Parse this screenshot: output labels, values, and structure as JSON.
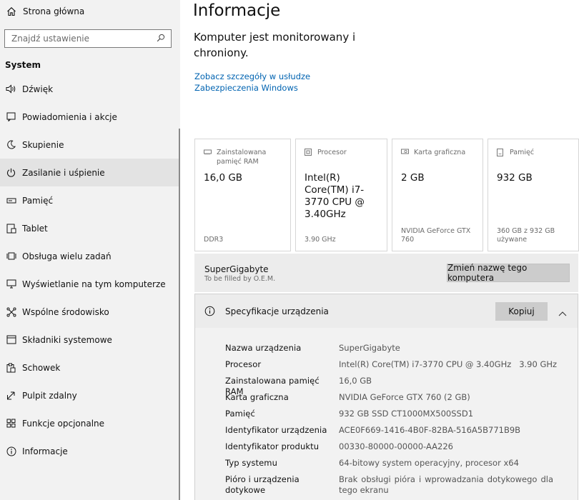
{
  "sidebar": {
    "home_label": "Strona główna",
    "search_placeholder": "Znajdź ustawienie",
    "section_title": "System",
    "items": [
      {
        "label": "Dźwięk",
        "icon": "speaker-icon"
      },
      {
        "label": "Powiadomienia i akcje",
        "icon": "notification-icon"
      },
      {
        "label": "Skupienie",
        "icon": "moon-icon"
      },
      {
        "label": "Zasilanie i uśpienie",
        "icon": "power-icon",
        "active": true
      },
      {
        "label": "Pamięć",
        "icon": "storage-icon"
      },
      {
        "label": "Tablet",
        "icon": "tablet-icon"
      },
      {
        "label": "Obsługa wielu zadań",
        "icon": "multitasking-icon"
      },
      {
        "label": "Wyświetlanie na tym komputerze",
        "icon": "projecting-icon"
      },
      {
        "label": "Wspólne środowisko",
        "icon": "shared-experiences-icon"
      },
      {
        "label": "Składniki systemowe",
        "icon": "system-components-icon"
      },
      {
        "label": "Schowek",
        "icon": "clipboard-icon"
      },
      {
        "label": "Pulpit zdalny",
        "icon": "remote-desktop-icon"
      },
      {
        "label": "Funkcje opcjonalne",
        "icon": "optional-features-icon"
      },
      {
        "label": "Informacje",
        "icon": "info-icon"
      }
    ]
  },
  "main": {
    "title": "Informacje",
    "protected_text": "Komputer jest monitorowany i chroniony.",
    "security_link": "Zobacz szczegóły w usłudze Zabezpieczenia Windows",
    "cards": [
      {
        "label": "Zainstalowana pamięć RAM",
        "value": "16,0 GB",
        "footer": "DDR3",
        "icon": "ram-icon"
      },
      {
        "label": "Procesor",
        "value": "Intel(R) Core(TM) i7-3770 CPU @ 3.40GHz",
        "footer": "3.90 GHz",
        "icon": "processor-icon"
      },
      {
        "label": "Karta graficzna",
        "value": "2 GB",
        "footer": "NVIDIA GeForce GTX 760",
        "icon": "graphics-card-icon"
      },
      {
        "label": "Pamięć",
        "value": "932 GB",
        "footer": "360 GB z 932 GB używane",
        "icon": "storage-icon"
      }
    ],
    "device": {
      "name": "SuperGigabyte",
      "oem": "To be filled by O.E.M.",
      "rename_label": "Zmień nazwę tego komputera"
    },
    "specs": {
      "title": "Specyfikacje urządzenia",
      "copy_label": "Kopiuj",
      "rows": [
        {
          "key": "Nazwa urządzenia",
          "value": "SuperGigabyte"
        },
        {
          "key": "Procesor",
          "value": "Intel(R) Core(TM) i7-3770 CPU @ 3.40GHz   3.90 GHz"
        },
        {
          "key": "Zainstalowana pamięć RAM",
          "value": "16,0 GB"
        },
        {
          "key": "Karta graficzna",
          "value": "NVIDIA GeForce GTX 760 (2 GB)"
        },
        {
          "key": "Pamięć",
          "value": "932 GB SSD CT1000MX500SSD1"
        },
        {
          "key": "Identyfikator urządzenia",
          "value": "ACE0F669-1416-4B0F-82BA-516A5B771B9B"
        },
        {
          "key": "Identyfikator produktu",
          "value": "00330-80000-00000-AA226"
        },
        {
          "key": "Typ systemu",
          "value": "64-bitowy system operacyjny, procesor x64"
        },
        {
          "key": "Pióro i urządzenia dotykowe",
          "value": "Brak obsługi pióra i wprowadzania dotykowego dla tego ekranu"
        }
      ]
    }
  },
  "colors": {
    "link": "#0063b1",
    "sidebar_bg": "#f2f2f2",
    "active_item_bg": "#e3e3e3",
    "button_bg": "#cccccc"
  }
}
